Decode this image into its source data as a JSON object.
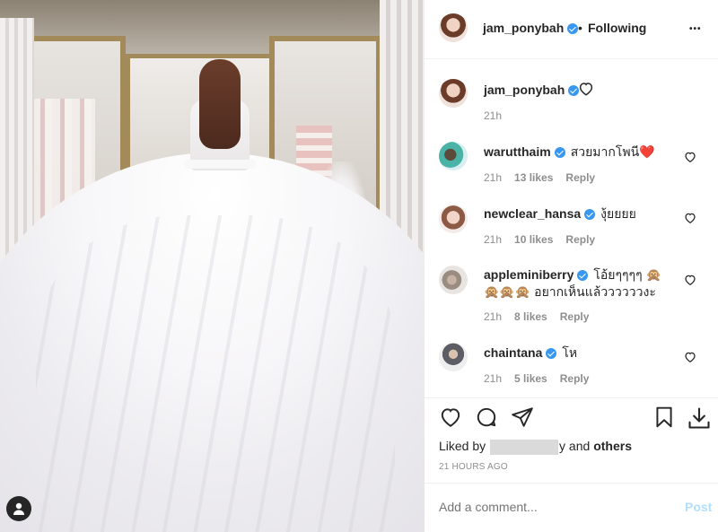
{
  "post": {
    "author": "jam_ponybah",
    "follow_separator": "•",
    "follow_status": "Following",
    "more_label": "•••",
    "caption_time": "21h"
  },
  "comments": [
    {
      "user": "warutthaim",
      "text": "สวยมากโพนี❤️",
      "time": "21h",
      "likes": "13 likes",
      "reply": "Reply"
    },
    {
      "user": "newclear_hansa",
      "text": "งุ้ยยยย",
      "time": "21h",
      "likes": "10 likes",
      "reply": "Reply"
    },
    {
      "user": "appleminiberry",
      "text": "โอ้ยๆๆๆๆ 🙊",
      "text2": "🙊🙊🙊 อยากเห็นแล้ววววววงะ",
      "time": "21h",
      "likes": "8 likes",
      "reply": "Reply"
    },
    {
      "user": "chaintana",
      "text": "โห",
      "time": "21h",
      "likes": "5 likes",
      "reply": "Reply"
    }
  ],
  "liked_by": {
    "prefix": "Liked by",
    "suffix": "y and",
    "others": "others"
  },
  "timestamp": "21 HOURS AGO",
  "comment_input": {
    "placeholder": "Add a comment...",
    "post_label": "Post"
  },
  "colors": {
    "verified": "#3897f0",
    "muted": "#8e8e8e",
    "post_disabled": "#b2dffc",
    "text": "#262626"
  }
}
